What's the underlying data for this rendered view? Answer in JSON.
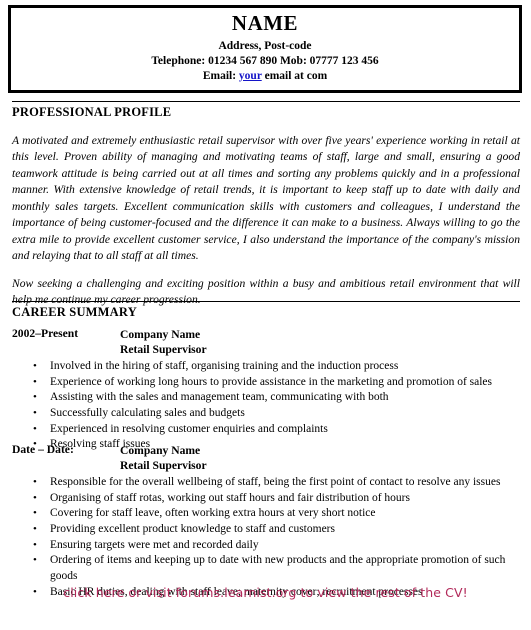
{
  "header": {
    "name": "NAME",
    "address": "Address, Post-code",
    "phone_line": "Telephone: 01234 567 890  Mob: 07777 123 456",
    "email_prefix": "Email: ",
    "email_link_text": "your",
    "email_suffix": " email at com",
    "link_color": "#1414c8",
    "border_color": "#000000"
  },
  "profile": {
    "title": "PROFESSIONAL PROFILE",
    "paragraphs": [
      "A motivated and extremely enthusiastic retail supervisor with over five years' experience working in retail at this level.  Proven ability of managing and motivating teams of staff, large and small, ensuring a good teamwork attitude is being carried out at all times and sorting any problems quickly and in a professional manner.  With extensive knowledge of retail trends, it is important to keep staff up to date with daily and monthly sales targets.  Excellent communication skills with customers and colleagues, I understand the importance of being customer-focused and the difference it can make to a business. Always willing to go the extra mile to provide excellent customer service, I also understand the importance of the company's mission and relaying that to all staff at all times.",
      "Now seeking a challenging and exciting position within a busy and ambitious retail environment that will help me continue my career progression."
    ]
  },
  "career": {
    "title": "CAREER SUMMARY",
    "jobs": [
      {
        "dates": "2002–Present",
        "company": "Company Name",
        "role": "Retail Supervisor",
        "bullets": [
          "Involved in the hiring of staff, organising training and the induction process",
          "Experience of working long hours to provide assistance in the marketing and promotion of sales",
          "Assisting with the sales and management team, communicating with both",
          "Successfully calculating sales and budgets",
          "Experienced in resolving customer enquiries and complaints",
          "Resolving staff issues"
        ]
      },
      {
        "dates": "Date – Date:",
        "company": "Company Name",
        "role": "Retail Supervisor",
        "bullets": [
          "Responsible for the overall wellbeing of staff, being the first point of contact to resolve any issues",
          "Organising of staff rotas, working out staff hours and fair distribution of hours",
          "Covering for staff leave, often working extra hours at very short notice",
          "Providing excellent product knowledge to staff and customers",
          "Ensuring targets were met and recorded daily",
          "Ordering of items and keeping up to date with new products and the appropriate promotion of such goods",
          "Basic HR duties, dealing with staff leave; maternity cover; recruitment processes"
        ]
      }
    ],
    "bullet_glyph": "•"
  },
  "footer": {
    "cta_text": "click here or visit forums.learnist.org to view the rest of the CV!",
    "cta_color": "#b2295a"
  }
}
